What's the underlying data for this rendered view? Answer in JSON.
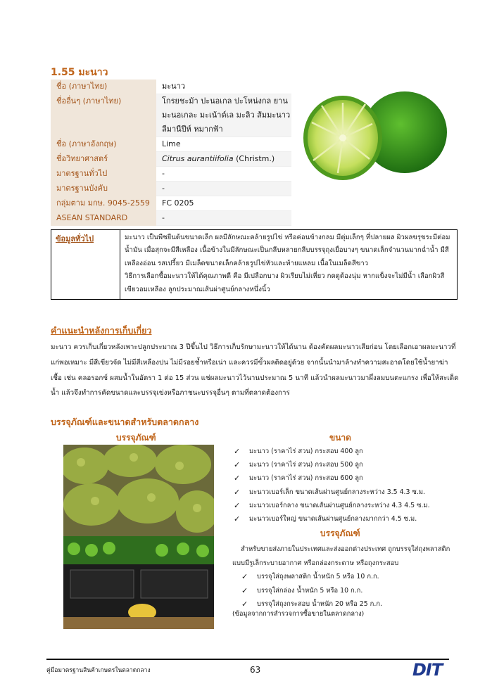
{
  "section_title": "1.55 มะนาว",
  "info": [
    {
      "k": "ชื่อ (ภาษาไทย)",
      "v": "มะนาว"
    },
    {
      "k": "ชื่ออื่นๆ (ภาษาไทย)",
      "v": "โกรยชะม้า ปะนอเกล ปะโหน่งกล ยาน มะนอเกละ มะเน้าด์เล มะลิว ส้มมะนาว ลีมานีปีห์ หมากฟ้า"
    },
    {
      "k": "ชื่อ (ภาษาอังกฤษ)",
      "v": "Lime"
    },
    {
      "k": "ชื่อวิทยาศาสตร์",
      "v_italic": "Citrus aurantiifolia",
      "v": " (Christm.)"
    },
    {
      "k": "มาตรฐานทั่วไป",
      "v": "-"
    },
    {
      "k": "มาตรฐานบังคับ",
      "v": "-"
    },
    {
      "k": "กลุ่มตาม มกษ. 9045-2559",
      "v": "FC 0205"
    },
    {
      "k": "ASEAN STANDARD",
      "v": "-"
    }
  ],
  "general": {
    "label": "ข้อมูลทั่วไป",
    "text1": "มะนาว เป็นพืชยืนต้นขนาดเล็ก ผลมีลักษณะคล้ายรูปไข่ หรือค่อนข้างกลม มีตุ่มเล็กๆ ที่ปลายผล ผิวผลขรุขระมีต่อมน้ำมัน เมื่อสุกจะมีสีเหลือง เนื้อข้างในมีลักษณะเป็นกลีบหลายกลีบบรรจุถุงเยื่อบางๆ ขนาดเล็กจำนวนมากฉ่ำน้ำ มีสีเหลืองอ่อน รสเปรี้ยว มีเมล็ดขนาดเล็กคล้ายรูปไข่หัวและท้ายแหลม เนื้อในเมล็ดสีขาว",
    "text2": "วิธีการเลือกซื้อมะนาวให้ได้คุณภาพดี คือ มีเปลือกบาง ผิวเรียบไม่เหี่ยว กดดูต้องนุ่ม หากแข็งจะไม่มีน้ำ เลือกผิวสีเขียวอมเหลือง ลูกประมาณเส้นผ่าศูนย์กลางหนึ่งนิ้ว"
  },
  "harvest": {
    "heading": "คำแนะนำหลังการเก็บเกี่ยว",
    "text": "มะนาว ควรเก็บเกี่ยวหลังเพาะปลูกประมาณ 3 ปีขึ้นไป วิธีการเก็บรักษามะนาวให้ได้นาน ต้องคัดผลมะนาวเสียก่อน โดยเลือกเอาผลมะนาวที่แก่พอเหมาะ มีสีเขียวจัด ไม่มีสีเหลืองปน ไม่มีรอยช้ำหรือเน่า และควรมีขั้วผลติดอยู่ด้วย จากนั้นนำมาล้างทำความสะอาดโดยใช้น้ำยาฆ่าเชื้อ เช่น คลอรอกซ์ ผสมน้ำในอัตรา 1 ต่อ 15 ส่วน แช่ผลมะนาวไว้นานประมาณ 5 นาที แล้วนำผลมะนาวมาผึ่งลมบนตะแกรง เพื่อให้สะเด็ดน้ำ แล้วจึงทำการคัดขนาดและบรรจุเข่งหรือภาชนะบรรจุอื่นๆ ตามที่ตลาดต้องการ"
  },
  "packaging": {
    "heading": "บรรจุภัณฑ์และขนาดสำหรับตลาดกลาง",
    "image_heading": "บรรจุภัณฑ์",
    "size_heading": "ขนาด",
    "sizes": [
      "มะนาว (ราคาไร่   สวน) กระสอบ 400 ลูก",
      "มะนาว (ราคาไร่   สวน) กระสอบ 500 ลูก",
      "มะนาว (ราคาไร่   สวน) กระสอบ 600 ลูก",
      "มะนาวเบอร์เล็ก ขนาดเส้นผ่านศูนย์กลางระหว่าง 3.5 4.3 ซ.ม.",
      "มะนาวเบอร์กลาง ขนาดเส้นผ่านศูนย์กลางระหว่าง 4.3 4.5 ซ.ม.",
      "มะนาวเบอร์ใหญ่ ขนาดเส้นผ่านศูนย์กลางมากกว่า 4.5 ซ.ม."
    ],
    "pack_heading": "บรรจุภัณฑ์",
    "pack_text": "สำหรับขายส่งภายในประเทศและส่งออกต่างประเทศ ถูกบรรจุใส่ถุงพลาสติกแบบมีรูเล็กระบายอากาศ หรือกล่องกระดาษ หรือถุงกระสอบ",
    "pack_items": [
      "บรรจุใส่ถุงพลาสติก น้ำหนัก 5 หรือ 10 ก.ก.",
      "บรรจุใส่กล่อง น้ำหนัก 5 หรือ 10 ก.ก.",
      "บรรจุใส่ถุงกระสอบ น้ำหนัก 20 หรือ 25 ก.ก."
    ],
    "source": "(ข้อมูลจากการสำรวจการซื้อขายในตลาดกลาง)"
  },
  "footer": {
    "text": "คู่มือมาตรฐานสินค้าเกษตรในตลาดกลาง",
    "page": "63",
    "logo": "DIT"
  },
  "icons": {
    "check": "check-icon"
  },
  "colors": {
    "accent": "#c0651b",
    "label_bg": "#f0e6da",
    "logo": "#1f3a8f"
  }
}
